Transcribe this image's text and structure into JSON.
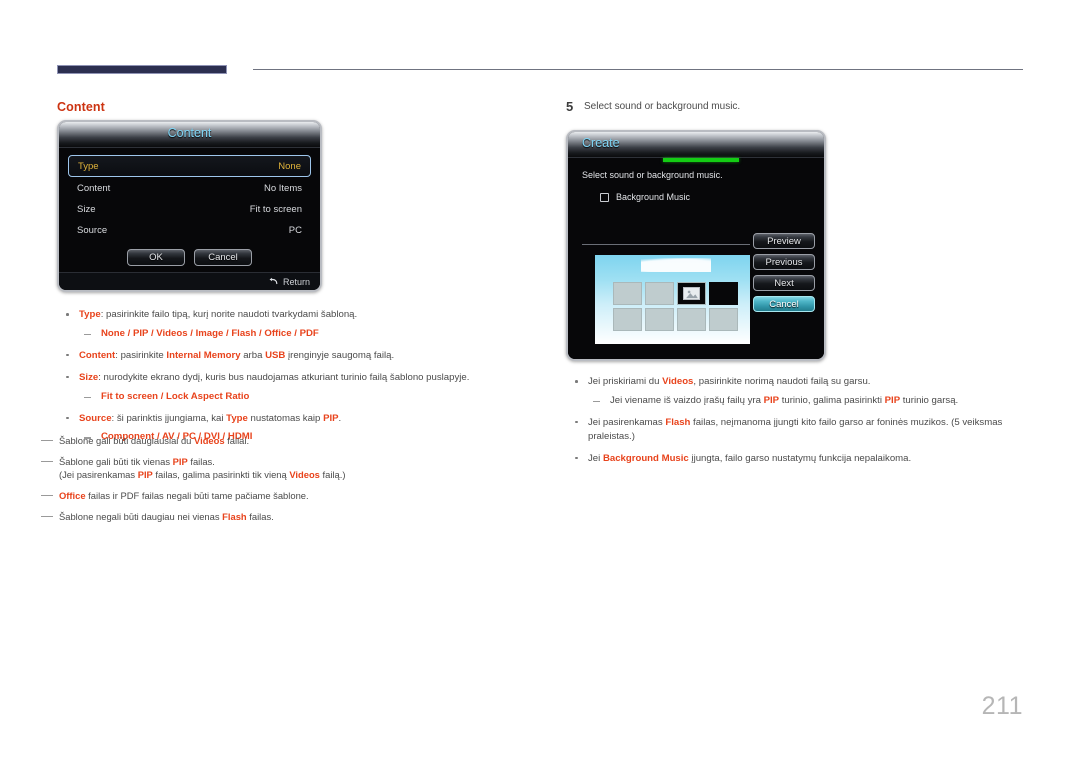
{
  "page": {
    "number": "211"
  },
  "left_column": {
    "heading": "Content",
    "dialog": {
      "title": "Content",
      "rows": [
        {
          "label": "Type",
          "value": "None",
          "selected": true
        },
        {
          "label": "Content",
          "value": "No Items",
          "selected": false
        },
        {
          "label": "Size",
          "value": "Fit to screen",
          "selected": false
        },
        {
          "label": "Source",
          "value": "PC",
          "selected": false
        }
      ],
      "ok_label": "OK",
      "cancel_label": "Cancel",
      "return_label": "Return",
      "return_icon": "return-arrow-icon"
    },
    "bullets": [
      {
        "segments": [
          {
            "t": "Type",
            "s": "em"
          },
          {
            "t": ": pasirinkite failo tipą, kurį norite naudoti tvarkydami šabloną.",
            "s": "plain"
          }
        ],
        "sub": [
          {
            "segments": [
              {
                "t": "None",
                "s": "em"
              },
              {
                "t": " / ",
                "s": "em"
              },
              {
                "t": "PIP",
                "s": "em"
              },
              {
                "t": " / ",
                "s": "em"
              },
              {
                "t": "Videos",
                "s": "em"
              },
              {
                "t": " / ",
                "s": "em"
              },
              {
                "t": "Image",
                "s": "em"
              },
              {
                "t": " / ",
                "s": "em"
              },
              {
                "t": "Flash",
                "s": "em"
              },
              {
                "t": " / ",
                "s": "em"
              },
              {
                "t": "Office",
                "s": "em"
              },
              {
                "t": " / ",
                "s": "em"
              },
              {
                "t": "PDF",
                "s": "em"
              }
            ]
          }
        ]
      },
      {
        "segments": [
          {
            "t": "Content",
            "s": "em"
          },
          {
            "t": ": pasirinkite ",
            "s": "plain"
          },
          {
            "t": "Internal Memory",
            "s": "em"
          },
          {
            "t": " arba ",
            "s": "plain"
          },
          {
            "t": "USB",
            "s": "em"
          },
          {
            "t": " įrenginyje saugomą failą.",
            "s": "plain"
          }
        ],
        "sub": []
      },
      {
        "segments": [
          {
            "t": "Size",
            "s": "em"
          },
          {
            "t": ": nurodykite ekrano dydį, kuris bus naudojamas atkuriant turinio failą šablono puslapyje.",
            "s": "plain"
          }
        ],
        "sub": [
          {
            "segments": [
              {
                "t": "Fit to screen",
                "s": "em"
              },
              {
                "t": " / ",
                "s": "em"
              },
              {
                "t": "Lock Aspect Ratio",
                "s": "em"
              }
            ]
          }
        ]
      },
      {
        "segments": [
          {
            "t": "Source",
            "s": "em"
          },
          {
            "t": ": ši parinktis įjungiama, kai ",
            "s": "plain"
          },
          {
            "t": "Type",
            "s": "em"
          },
          {
            "t": " nustatomas kaip ",
            "s": "plain"
          },
          {
            "t": "PIP",
            "s": "em"
          },
          {
            "t": ".",
            "s": "plain"
          }
        ],
        "sub": [
          {
            "segments": [
              {
                "t": "Component",
                "s": "em"
              },
              {
                "t": " / ",
                "s": "em"
              },
              {
                "t": "AV",
                "s": "em"
              },
              {
                "t": " / ",
                "s": "em"
              },
              {
                "t": "PC",
                "s": "em"
              },
              {
                "t": " / ",
                "s": "em"
              },
              {
                "t": "DVI",
                "s": "em"
              },
              {
                "t": " / ",
                "s": "em"
              },
              {
                "t": "HDMI",
                "s": "em"
              }
            ]
          }
        ]
      }
    ],
    "notes": [
      {
        "segments": [
          {
            "t": "Šablone gali būti daugiausiai du ",
            "s": "plain"
          },
          {
            "t": "Videos",
            "s": "em"
          },
          {
            "t": " failai.",
            "s": "plain"
          }
        ]
      },
      {
        "segments": [
          {
            "t": "Šablone gali būti tik vienas ",
            "s": "plain"
          },
          {
            "t": "PIP",
            "s": "em"
          },
          {
            "t": " failas.",
            "s": "plain"
          },
          {
            "t": "\n",
            "s": "br"
          },
          {
            "t": "(Jei pasirenkamas ",
            "s": "plain"
          },
          {
            "t": "PIP",
            "s": "em"
          },
          {
            "t": " failas, galima pasirinkti tik vieną ",
            "s": "plain"
          },
          {
            "t": "Videos",
            "s": "em"
          },
          {
            "t": " failą.)",
            "s": "plain"
          }
        ]
      },
      {
        "segments": [
          {
            "t": "Office",
            "s": "em"
          },
          {
            "t": " failas ir PDF failas negali būti tame pačiame šablone.",
            "s": "plain"
          }
        ]
      },
      {
        "segments": [
          {
            "t": "Šablone negali būti daugiau nei vienas ",
            "s": "plain"
          },
          {
            "t": "Flash",
            "s": "em"
          },
          {
            "t": " failas.",
            "s": "plain"
          }
        ]
      }
    ]
  },
  "right_column": {
    "step_number": "5",
    "step_text": "Select sound or background music.",
    "dialog": {
      "title": "Create",
      "instruction": "Select sound or background music.",
      "checkbox_label": "Background Music",
      "checkbox_checked": false,
      "progress_color": "#14cc14",
      "buttons": [
        {
          "label": "Preview",
          "accent": false
        },
        {
          "label": "Previous",
          "accent": false
        },
        {
          "label": "Next",
          "accent": false
        },
        {
          "label": "Cancel",
          "accent": true
        }
      ],
      "preview_tiles": [
        "plain",
        "plain",
        "media",
        "dark",
        "plain",
        "plain",
        "plain",
        "plain"
      ]
    },
    "bullets": [
      {
        "segments": [
          {
            "t": "Jei priskiriami du ",
            "s": "plain"
          },
          {
            "t": "Videos",
            "s": "em"
          },
          {
            "t": ", pasirinkite norimą naudoti failą su garsu.",
            "s": "plain"
          }
        ],
        "sub": [
          {
            "segments": [
              {
                "t": "Jei viename iš vaizdo įrašų failų yra ",
                "s": "plain"
              },
              {
                "t": "PIP",
                "s": "em"
              },
              {
                "t": " turinio, galima pasirinkti ",
                "s": "plain"
              },
              {
                "t": "PIP",
                "s": "em"
              },
              {
                "t": " turinio garsą.",
                "s": "plain"
              }
            ]
          }
        ]
      },
      {
        "segments": [
          {
            "t": "Jei pasirenkamas ",
            "s": "plain"
          },
          {
            "t": "Flash",
            "s": "em"
          },
          {
            "t": " failas, neįmanoma įjungti kito failo garso ar foninės muzikos. (5 veiksmas praleistas.)",
            "s": "plain"
          }
        ],
        "sub": []
      },
      {
        "segments": [
          {
            "t": "Jei ",
            "s": "plain"
          },
          {
            "t": "Background Music",
            "s": "em"
          },
          {
            "t": " įjungta, failo garso nustatymų funkcija nepalaikoma.",
            "s": "plain"
          }
        ],
        "sub": []
      }
    ]
  }
}
